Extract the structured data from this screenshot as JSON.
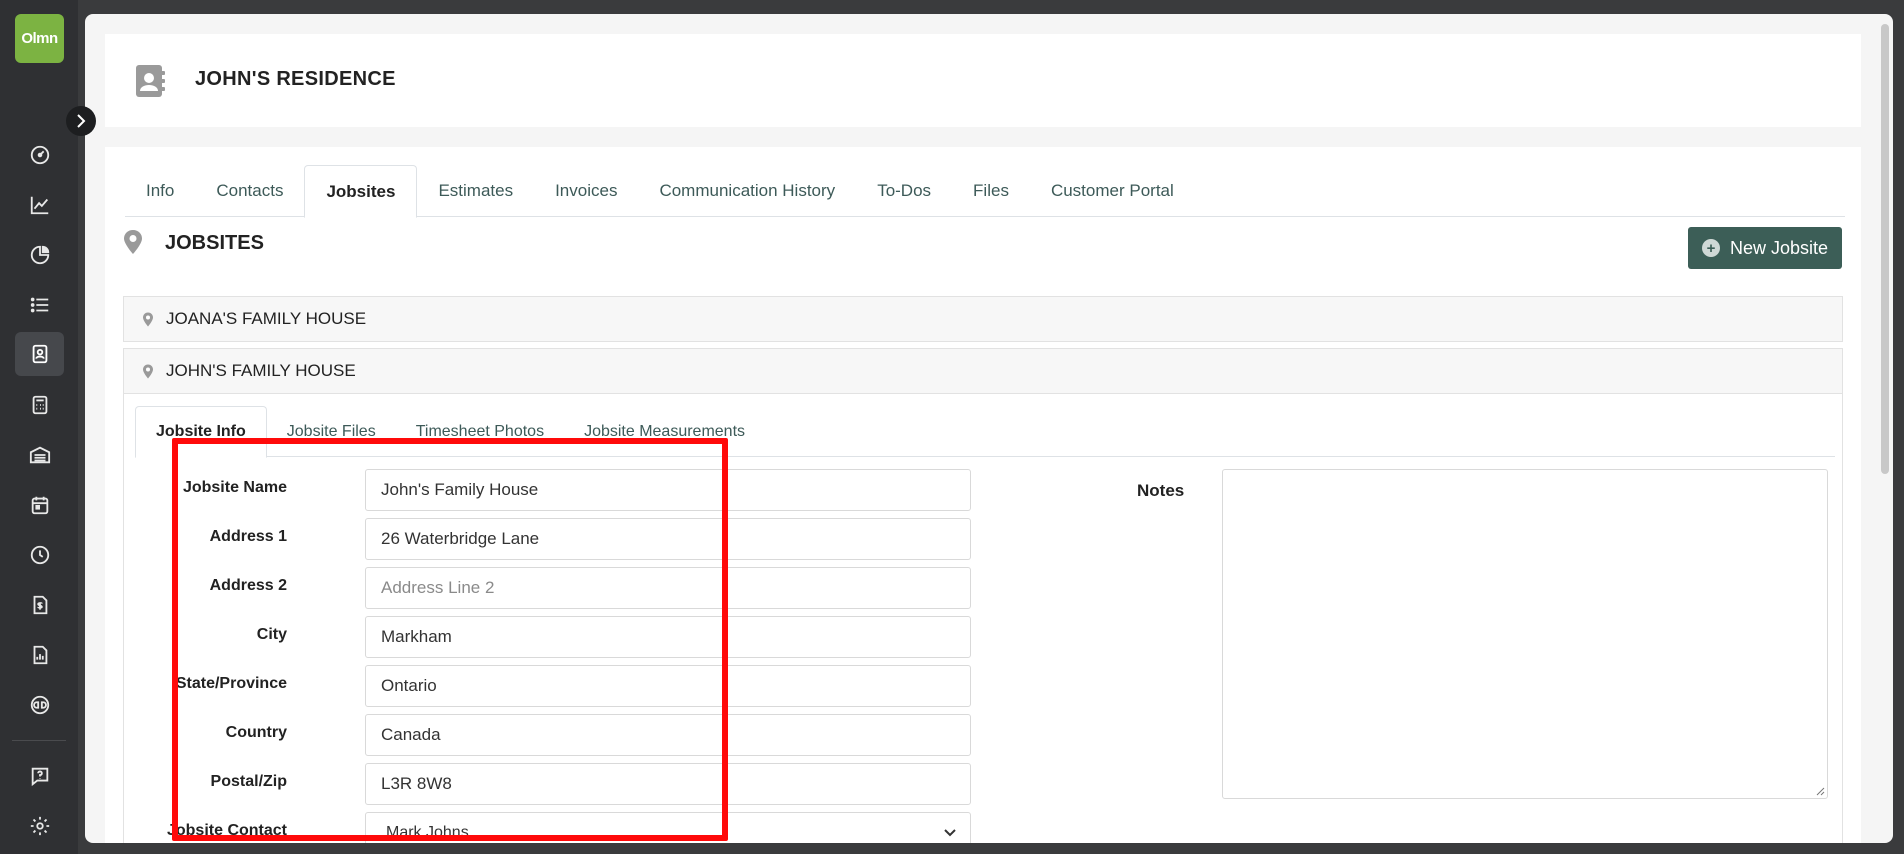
{
  "app": {
    "logo_text": "Olmn"
  },
  "header": {
    "title": "JOHN'S RESIDENCE"
  },
  "tabs": [
    {
      "label": "Info"
    },
    {
      "label": "Contacts"
    },
    {
      "label": "Jobsites"
    },
    {
      "label": "Estimates"
    },
    {
      "label": "Invoices"
    },
    {
      "label": "Communication History"
    },
    {
      "label": "To-Dos"
    },
    {
      "label": "Files"
    },
    {
      "label": "Customer Portal"
    }
  ],
  "active_tab": "Jobsites",
  "section": {
    "title": "JOBSITES",
    "new_button": "New Jobsite"
  },
  "jobsites": [
    {
      "name": "JOANA'S FAMILY HOUSE"
    },
    {
      "name": "JOHN'S FAMILY HOUSE"
    }
  ],
  "subtabs": [
    {
      "label": "Jobsite Info"
    },
    {
      "label": "Jobsite Files"
    },
    {
      "label": "Timesheet Photos"
    },
    {
      "label": "Jobsite Measurements"
    }
  ],
  "form": {
    "jobsite_name": {
      "label": "Jobsite Name",
      "value": "John's Family House"
    },
    "address1": {
      "label": "Address 1",
      "value": "26 Waterbridge Lane"
    },
    "address2": {
      "label": "Address 2",
      "placeholder": "Address Line 2"
    },
    "city": {
      "label": "City",
      "value": "Markham"
    },
    "state": {
      "label": "State/Province",
      "value": "Ontario"
    },
    "country": {
      "label": "Country",
      "value": "Canada"
    },
    "postal": {
      "label": "Postal/Zip",
      "value": "L3R 8W8"
    },
    "contact": {
      "label": "Jobsite Contact",
      "value": "Mark Johns"
    }
  },
  "notes": {
    "label": "Notes"
  },
  "colors": {
    "accent": "#3c5e57",
    "logo": "#7cb342",
    "highlight": "#ff0a0a",
    "sidebar": "#2f3033"
  }
}
